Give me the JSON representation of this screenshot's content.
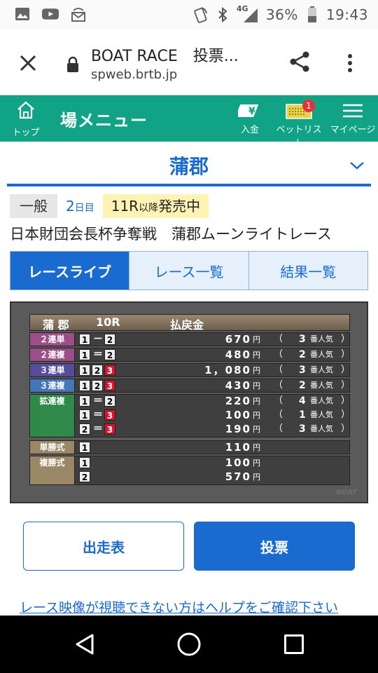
{
  "status_bar": {
    "network": "4G",
    "battery": "36%",
    "time": "19:43"
  },
  "browser": {
    "title": "BOAT RACE　投票...",
    "url": "spweb.brtb.jp"
  },
  "nav": {
    "home_label": "トップ",
    "menu_title": "場メニュー",
    "deposit_label": "入金",
    "betlist_label": "ベットリスト",
    "betlist_badge": "1",
    "mypage_label": "マイページ"
  },
  "venue": {
    "name": "蒲郡"
  },
  "race_info": {
    "grade": "一般",
    "day_num": "2",
    "day_suffix": "日目",
    "sale_race": "11R",
    "sale_after": "以降",
    "sale_status": "発売中",
    "title": "日本財団会長杯争奪戦　蒲郡ムーンライトレース"
  },
  "tabs": [
    {
      "label": "レースライブ",
      "active": true
    },
    {
      "label": "レース一覧",
      "active": false
    },
    {
      "label": "結果一覧",
      "active": false
    }
  ],
  "payout_board": {
    "venue": "蒲 郡",
    "race": "10R",
    "heading": "払戻金",
    "yen": "円",
    "pop_prefix": "（",
    "pop_suffix": "番人気",
    "pop_close": "）",
    "rows": {
      "exacta": {
        "label": "２連単",
        "n1": "1",
        "sep": "－",
        "n2": "2",
        "amount": "670",
        "pop": "3"
      },
      "quinella": {
        "label": "２連複",
        "n1": "1",
        "sep": "＝",
        "n2": "2",
        "amount": "480",
        "pop": "2"
      },
      "trifecta": {
        "label": "３連単",
        "n1": "1",
        "n2": "2",
        "n3": "3",
        "amount": "1，080",
        "pop": "3"
      },
      "trio": {
        "label": "３連複",
        "n1": "1",
        "n2": "2",
        "n3": "3",
        "amount": "430",
        "pop": "2"
      },
      "wide_label": "拡連複",
      "wide": [
        {
          "n1": "1",
          "sep": "＝",
          "n2": "2",
          "amount": "220",
          "pop": "4"
        },
        {
          "n1": "1",
          "sep": "＝",
          "n2": "3",
          "amount": "100",
          "pop": "1"
        },
        {
          "n1": "2",
          "sep": "＝",
          "n2": "3",
          "amount": "190",
          "pop": "3"
        }
      ],
      "win": {
        "label": "単勝式",
        "n1": "1",
        "amount": "110"
      },
      "place_label": "複勝式",
      "place": [
        {
          "n1": "1",
          "amount": "100"
        },
        {
          "n1": "2",
          "amount": "570"
        }
      ]
    },
    "watermark": "BOAT"
  },
  "buttons": {
    "entry_list": "出走表",
    "vote": "投票"
  },
  "help_link": "レース映像が視聴できない方はヘルプをご確認下さい",
  "colors": {
    "brand_green": "#11a386",
    "accent_blue": "#1a6bd0",
    "sale_yellow": "#fff3b3"
  }
}
